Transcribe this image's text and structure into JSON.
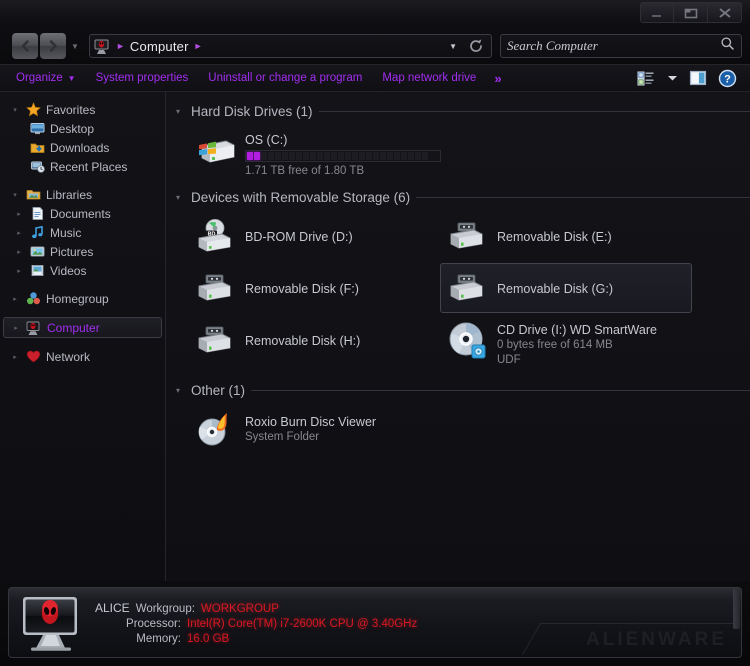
{
  "titlebar": {
    "minimize_label": "Minimize",
    "restore_label": "Restore",
    "close_label": "Close"
  },
  "nav": {
    "back_label": "Back",
    "forward_label": "Forward",
    "recent_label": "Recent pages",
    "breadcrumb_root": "Computer",
    "refresh_label": "Refresh",
    "address_icon": "computer-icon"
  },
  "search": {
    "placeholder": "Search Computer",
    "value": "",
    "icon": "search-icon"
  },
  "toolbar": {
    "items": [
      {
        "label": "Organize",
        "has_arrow": true
      },
      {
        "label": "System properties",
        "has_arrow": false
      },
      {
        "label": "Uninstall or change a program",
        "has_arrow": false
      },
      {
        "label": "Map network drive",
        "has_arrow": false
      },
      {
        "label": "»",
        "has_arrow": false
      }
    ],
    "views_label": "Change your view",
    "preview_label": "Show the preview pane",
    "help_label": "Get help"
  },
  "sidebar": {
    "groups": [
      {
        "header": {
          "label": "Favorites",
          "icon": "star-icon",
          "expander": "▾"
        },
        "items": [
          {
            "label": "Desktop",
            "icon": "desktop-icon",
            "expander": ""
          },
          {
            "label": "Downloads",
            "icon": "downloads-icon",
            "expander": ""
          },
          {
            "label": "Recent Places",
            "icon": "recent-places-icon",
            "expander": ""
          }
        ]
      },
      {
        "header": {
          "label": "Libraries",
          "icon": "libraries-icon",
          "expander": "▾"
        },
        "items": [
          {
            "label": "Documents",
            "icon": "documents-icon",
            "expander": "▸"
          },
          {
            "label": "Music",
            "icon": "music-icon",
            "expander": "▸"
          },
          {
            "label": "Pictures",
            "icon": "pictures-icon",
            "expander": "▸"
          },
          {
            "label": "Videos",
            "icon": "videos-icon",
            "expander": "▸"
          }
        ]
      },
      {
        "header": {
          "label": "Homegroup",
          "icon": "homegroup-icon",
          "expander": "▸"
        },
        "items": []
      },
      {
        "header": {
          "label": "Computer",
          "icon": "computer-alien-icon",
          "expander": "▸",
          "selected": true
        },
        "items": []
      },
      {
        "header": {
          "label": "Network",
          "icon": "network-icon",
          "expander": "▸"
        },
        "items": []
      }
    ]
  },
  "content": {
    "groups": [
      {
        "title": "Hard Disk Drives (1)",
        "expander": "▾",
        "tiles": [
          {
            "name": "OS (C:)",
            "sub": "1.71 TB free of 1.80 TB",
            "icon": "hard-drive-windows-icon",
            "bar": {
              "segments": 26,
              "filled": 2
            },
            "selected": false
          }
        ]
      },
      {
        "title": "Devices with Removable Storage (6)",
        "expander": "▾",
        "tiles": [
          {
            "name": "BD-ROM Drive (D:)",
            "sub": "",
            "icon": "bd-rom-drive-icon",
            "selected": false
          },
          {
            "name": "Removable Disk (E:)",
            "sub": "",
            "icon": "removable-disk-icon",
            "selected": false
          },
          {
            "name": "Removable Disk (F:)",
            "sub": "",
            "icon": "removable-disk-icon",
            "selected": false
          },
          {
            "name": "Removable Disk (G:)",
            "sub": "",
            "icon": "removable-disk-icon",
            "selected": true
          },
          {
            "name": "Removable Disk (H:)",
            "sub": "",
            "icon": "removable-disk-icon",
            "selected": false
          },
          {
            "name": "CD Drive (I:) WD SmartWare",
            "sub": "0 bytes free of 614 MB",
            "sub2": "UDF",
            "icon": "cd-drive-icon",
            "selected": false
          }
        ]
      },
      {
        "title": "Other (1)",
        "expander": "▾",
        "tiles": [
          {
            "name": "Roxio Burn Disc Viewer",
            "sub": "System Folder",
            "icon": "roxio-burn-icon",
            "selected": false
          }
        ]
      }
    ]
  },
  "details": {
    "computer_name": "ALICE",
    "workgroup_label": "Workgroup:",
    "workgroup_value": "WORKGROUP",
    "processor_label": "Processor:",
    "processor_value": "Intel(R) Core(TM) i7-2600K CPU @ 3.40GHz",
    "memory_label": "Memory:",
    "memory_value": "16.0 GB",
    "brand_watermark": "ALIENWARE",
    "icon": "alienware-monitor-icon"
  },
  "colors": {
    "accent_purple": "#a22ef0",
    "accent_red": "#d81822",
    "bar_fill": "#b01ee0",
    "text_primary": "#c8c8d2",
    "text_secondary": "#86868f"
  }
}
